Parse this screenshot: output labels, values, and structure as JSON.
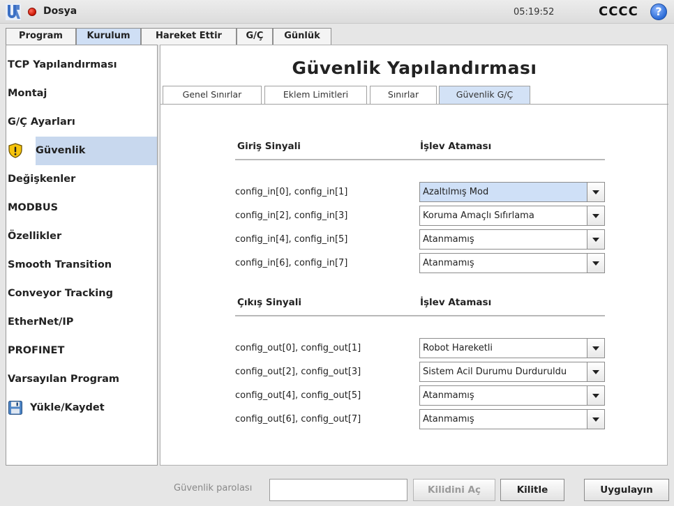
{
  "topbar": {
    "file_menu": "Dosya",
    "clock": "05:19:52",
    "robot_name": "CCCC",
    "help": "?"
  },
  "main_tabs": [
    {
      "label": "Program",
      "active": false
    },
    {
      "label": "Kurulum",
      "active": true
    },
    {
      "label": "Hareket Ettir",
      "active": false
    },
    {
      "label": "G/Ç",
      "active": false
    },
    {
      "label": "Günlük",
      "active": false
    }
  ],
  "sidebar": {
    "items": [
      {
        "label": "TCP Yapılandırması"
      },
      {
        "label": "Montaj"
      },
      {
        "label": "G/Ç Ayarları"
      },
      {
        "label": "Güvenlik",
        "icon": "warning-shield-icon",
        "active": true
      },
      {
        "label": "Değişkenler"
      },
      {
        "label": "MODBUS"
      },
      {
        "label": "Özellikler"
      },
      {
        "label": "Smooth Transition"
      },
      {
        "label": "Conveyor Tracking"
      },
      {
        "label": "EtherNet/IP"
      },
      {
        "label": "PROFINET"
      },
      {
        "label": "Varsayılan Program"
      },
      {
        "label": "Yükle/Kaydet",
        "icon": "floppy-disk-icon"
      }
    ]
  },
  "page": {
    "title": "Güvenlik Yapılandırması",
    "subtabs": [
      {
        "label": "Genel Sınırlar",
        "active": false
      },
      {
        "label": "Eklem Limitleri",
        "active": false
      },
      {
        "label": "Sınırlar",
        "active": false
      },
      {
        "label": "Güvenlik G/Ç",
        "active": true
      }
    ]
  },
  "inputs_section": {
    "signal_header": "Giriş Sinyali",
    "function_header": "İşlev Ataması",
    "rows": [
      {
        "signal": "config_in[0], config_in[1]",
        "value": "Azaltılmış Mod",
        "highlighted": true
      },
      {
        "signal": "config_in[2], config_in[3]",
        "value": "Koruma Amaçlı Sıfırlama"
      },
      {
        "signal": "config_in[4], config_in[5]",
        "value": "Atanmamış"
      },
      {
        "signal": "config_in[6], config_in[7]",
        "value": "Atanmamış"
      }
    ]
  },
  "outputs_section": {
    "signal_header": "Çıkış Sinyali",
    "function_header": "İşlev Ataması",
    "rows": [
      {
        "signal": "config_out[0], config_out[1]",
        "value": "Robot Hareketli"
      },
      {
        "signal": "config_out[2], config_out[3]",
        "value": "Sistem Acil Durumu Durduruldu"
      },
      {
        "signal": "config_out[4], config_out[5]",
        "value": "Atanmamış"
      },
      {
        "signal": "config_out[6], config_out[7]",
        "value": "Atanmamış"
      }
    ]
  },
  "bottombar": {
    "password_label": "Güvenlik parolası",
    "password_value": "",
    "unlock_label": "Kilidini Aç",
    "lock_label": "Kilitle",
    "apply_label": "Uygulayın"
  },
  "colors": {
    "active_tab": "#cfdff5",
    "selected_sidebar": "#c8d8ee",
    "highlighted_dropdown": "#cfe0f7",
    "status_dot": "#c81400",
    "help_icon": "#2b6bd6"
  }
}
